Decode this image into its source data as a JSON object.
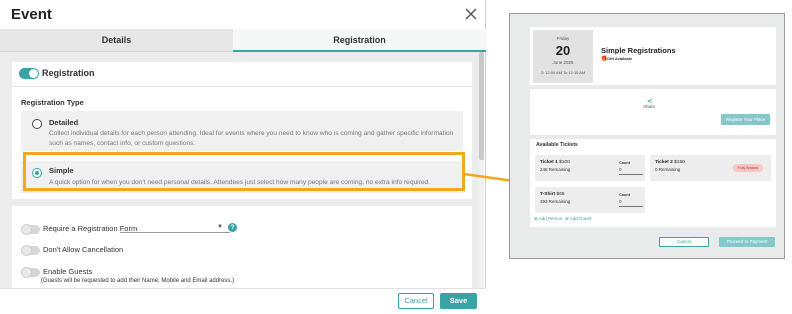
{
  "dialog": {
    "title": "Event",
    "tabs": [
      {
        "label": "Details",
        "active": false
      },
      {
        "label": "Registration",
        "active": true
      }
    ],
    "registration_toggle": {
      "label": "Registration",
      "on": true
    },
    "registration_type": {
      "label": "Registration Type",
      "options": [
        {
          "title": "Detailed",
          "description": "Collect individual details for each person attending. Ideal for events where you need to know who is coming and gather specific information such as names, contact info, or custom questions.",
          "selected": false
        },
        {
          "title": "Simple",
          "description": "A quick option for when you don't need personal details. Attendees just select how many people are coming, no extra info required.",
          "selected": true
        }
      ]
    },
    "settings": [
      {
        "label": "Require a Registration Form",
        "on": false
      },
      {
        "label": "Don't Allow Cancellation",
        "on": false
      },
      {
        "label": "Enable Guests",
        "on": false,
        "note": "(Guests will be requested to add their Name, Mobile and Email address.)"
      }
    ],
    "help_icon": "?",
    "footer": {
      "cancel_label": "Cancel",
      "save_label": "Save"
    }
  },
  "preview": {
    "event": {
      "day_of_week": "Friday",
      "day": "20",
      "month_year": "June 2025",
      "time": "⊙ 12:00 AM To 12:15 AM",
      "title": "Simple Registrations",
      "gift_label": "Gift Available"
    },
    "share_label": "Share",
    "register_button": "Register Your Place",
    "tickets_title": "Available Tickets",
    "tickets": [
      {
        "name": "Ticket 1",
        "price": "$100",
        "remaining": "248 Remaining",
        "count_label": "Count",
        "count": "0"
      },
      {
        "name": "Ticket 2",
        "price": "$150",
        "remaining": "0 Remaining",
        "badge": "Fully Booked"
      },
      {
        "name": "T-Shirt",
        "price": "$65",
        "remaining": "393 Remaining",
        "count_label": "Count",
        "count": "0"
      }
    ],
    "add_person": "⊕ Add Person",
    "add_guest": "⊕ Add Guest",
    "cancel_label": "Cancel",
    "proceed_label": "Proceed to Payment"
  },
  "colors": {
    "accent": "#3aa3a6",
    "highlight": "#f0a81c",
    "badge_bg": "#f5c6c6"
  }
}
